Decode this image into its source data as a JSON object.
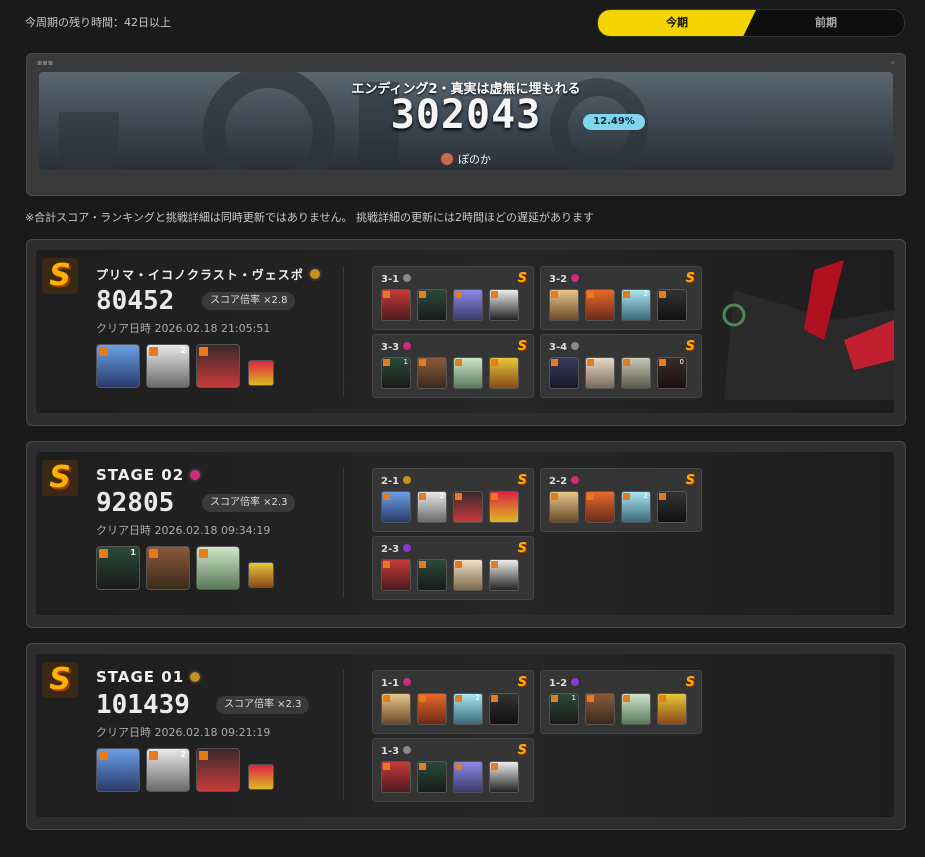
{
  "header": {
    "remaining": "今周期の残り時間：42日以上",
    "tab_current": "今期",
    "tab_previous": "前期"
  },
  "banner": {
    "title": "エンディング2・真実は虚無に埋もれる",
    "score": "302043",
    "percent": "12.49%",
    "player": "ぽのか"
  },
  "notice": "※合計スコア・ランキングと挑戦詳細は同時更新ではありません。 挑戦詳細の更新には2時間ほどの遅延があります",
  "colors": {
    "accent": "#f4d400",
    "rank": "#ffb000",
    "percent_bg": "#7fd5ee"
  },
  "stages": [
    {
      "rank": "S",
      "name": "プリマ・イコノクラスト・ヴェスポ",
      "score": "80452",
      "multiplier": "スコア倍率 ×2.8",
      "clear_time": "クリア日時 2026.02.18 21:05:51",
      "team_levels": [
        "",
        "2",
        ""
      ],
      "subs": [
        {
          "label": "3-1",
          "rank": "S",
          "levels": [
            "",
            "",
            "",
            ""
          ]
        },
        {
          "label": "3-2",
          "rank": "S",
          "levels": [
            "",
            "",
            "2",
            ""
          ]
        },
        {
          "label": "3-3",
          "rank": "S",
          "levels": [
            "1",
            "",
            "",
            ""
          ]
        },
        {
          "label": "3-4",
          "rank": "S",
          "levels": [
            "",
            "",
            "",
            "0"
          ]
        }
      ]
    },
    {
      "rank": "S",
      "name": "STAGE 02",
      "score": "92805",
      "multiplier": "スコア倍率 ×2.3",
      "clear_time": "クリア日時 2026.02.18 09:34:19",
      "team_levels": [
        "1",
        "",
        ""
      ],
      "subs": [
        {
          "label": "2-1",
          "rank": "S",
          "levels": [
            "",
            "2",
            "",
            ""
          ]
        },
        {
          "label": "2-2",
          "rank": "S",
          "levels": [
            "",
            "",
            "2",
            ""
          ]
        },
        {
          "label": "2-3",
          "rank": "S",
          "levels": [
            "",
            "",
            "",
            ""
          ]
        }
      ]
    },
    {
      "rank": "S",
      "name": "STAGE 01",
      "score": "101439",
      "multiplier": "スコア倍率 ×2.3",
      "clear_time": "クリア日時 2026.02.18 09:21:19",
      "team_levels": [
        "",
        "2",
        ""
      ],
      "subs": [
        {
          "label": "1-1",
          "rank": "S",
          "levels": [
            "",
            "",
            "2",
            ""
          ]
        },
        {
          "label": "1-2",
          "rank": "S",
          "levels": [
            "1",
            "",
            "",
            ""
          ]
        },
        {
          "label": "1-3",
          "rank": "S",
          "levels": [
            "",
            "",
            "",
            ""
          ]
        }
      ]
    }
  ]
}
